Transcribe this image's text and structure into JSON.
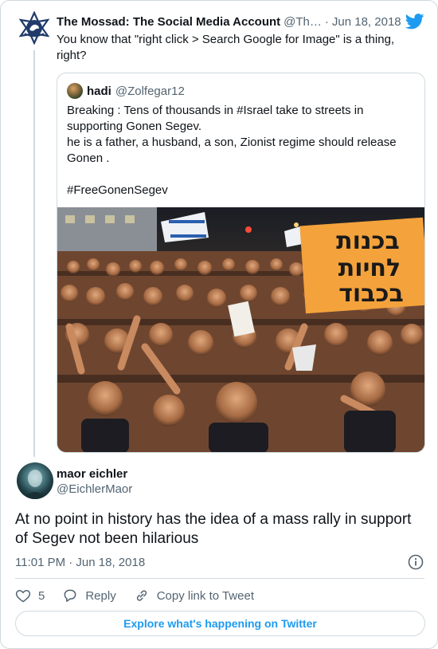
{
  "parent": {
    "name": "The Mossad: The Social Media Account",
    "handle": "@Th…",
    "separator": "·",
    "date": "Jun 18, 2018",
    "text": "You know that \"right click > Search Google for Image\" is a thing, right?"
  },
  "quoted": {
    "name": "hadi",
    "handle": "@Zolfegar12",
    "lines": [
      "Breaking : Tens of thousands in #Israel take to streets in supporting Gonen Segev.",
      "he is a father, a husband, a son, Zionist regime should release Gonen .",
      "",
      " #FreeGonenSegev"
    ],
    "sign_text": [
      "בכנות",
      "לחיות",
      "בכבוד"
    ]
  },
  "reply": {
    "name": "maor eichler",
    "handle": "@EichlerMaor",
    "text": "At no point in history has the idea of a mass rally in support of Segev not been hilarious",
    "time": "11:01 PM · Jun 18, 2018"
  },
  "actions": {
    "like_count": "5",
    "reply_label": "Reply",
    "copy_label": "Copy link to Tweet"
  },
  "explore_label": "Explore what's happening on Twitter",
  "colors": {
    "accent": "#1d9bf0",
    "text": "#0f1419",
    "secondary": "#536471",
    "border": "#cfd9de"
  },
  "icons": [
    "mossad-logo-icon",
    "twitter-bird-icon",
    "info-icon",
    "heart-icon",
    "reply-icon",
    "link-icon"
  ]
}
